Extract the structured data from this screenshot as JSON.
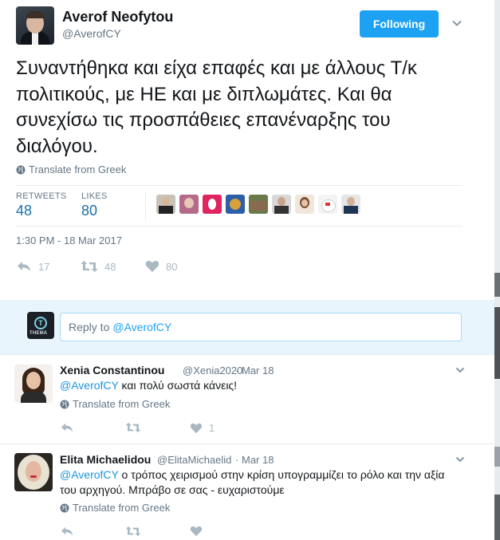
{
  "tweet": {
    "author_name": "Averof Neofytou",
    "author_handle": "@AverofCY",
    "follow_label": "Following",
    "text": "Συναντήθηκα και είχα επαφές και με άλλους Τ/κ πολιτικούς, με ΗΕ και με διπλωμάτες. Και θα συνεχίσω τις προσπάθειες επανέναρξης του διαλόγου.",
    "translate_label": "Translate from Greek",
    "stats": {
      "retweets_label": "RETWEETS",
      "retweets_value": "48",
      "likes_label": "LIKES",
      "likes_value": "80"
    },
    "timestamp": "1:30 PM - 18 Mar 2017",
    "actions": {
      "reply_count": "17",
      "retweet_count": "48",
      "like_count": "80"
    }
  },
  "reply_box": {
    "logo_text": "T",
    "logo_label": "THEMA",
    "placeholder_prefix": "Reply to",
    "placeholder_mention": "@AverofCY"
  },
  "replies": [
    {
      "name": "Xenia Constantinou",
      "handle": "@Xenia2020",
      "date": "Mar 18",
      "mention": "@AverofCY",
      "text": "και πολύ σωστά  κάνεις!",
      "translate_label": "Translate from Greek",
      "like_count": "1"
    },
    {
      "name": "Elita Michaelidou",
      "handle": "@ElitaMichaelid",
      "date": "Mar 18",
      "mention": "@AverofCY",
      "text_line1": "ο τρόπος χειρισμού στην κρίση υπογραμμίζει το ρόλο και την αξία",
      "text_line2": "του αρχηγού. Μπράβο σε σας - ευχαριστούμε",
      "translate_label": "Translate from Greek"
    }
  ],
  "colors": {
    "accent": "#1da1f2",
    "link": "#1b95e0",
    "stat_value": "#1b6fa8",
    "muted": "#657786",
    "icon": "#aab8c2",
    "reply_bg": "#e8f5fd"
  },
  "icons": {
    "globe": "globe-icon",
    "reply": "reply-icon",
    "retweet": "retweet-icon",
    "like": "heart-icon",
    "caret": "chevron-down-icon"
  }
}
